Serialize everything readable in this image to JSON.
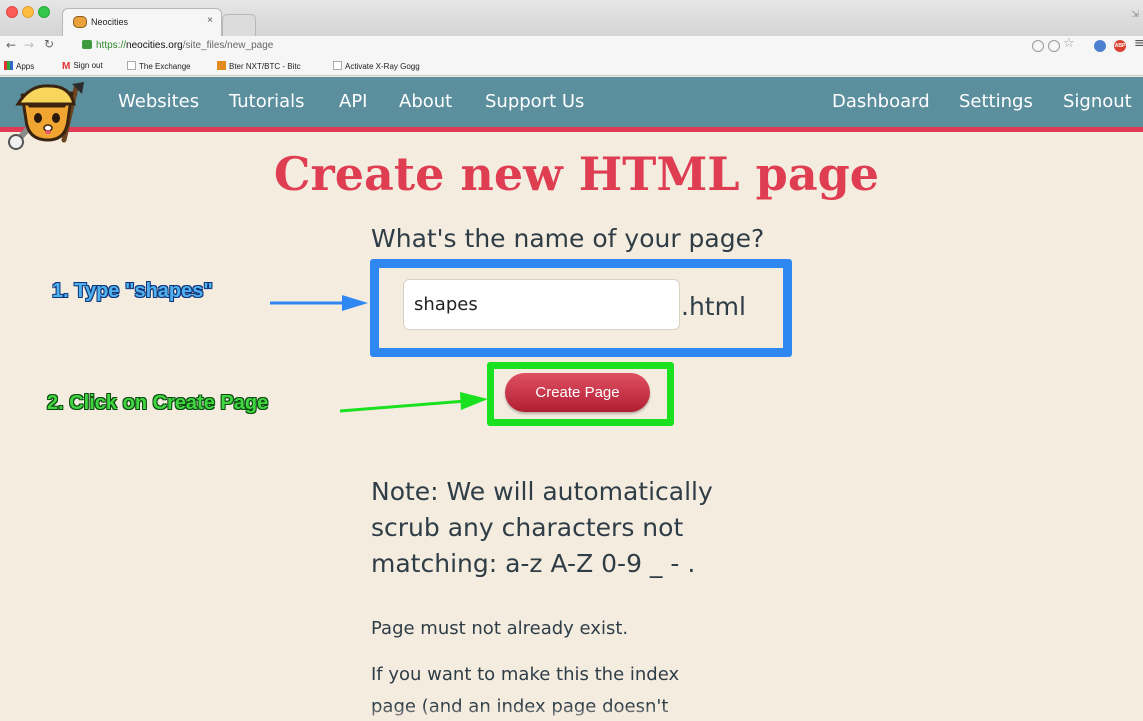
{
  "browser": {
    "tab_title": "Neocities",
    "tab_close": "×",
    "url_scheme": "https://",
    "url_host": "neocities.org",
    "url_path": "/site_files/new_page",
    "bookmarks": [
      "Apps",
      "Sign out",
      "The Exchange",
      "Bter NXT/BTC - Bitc",
      "Activate X-Ray Gogg"
    ],
    "toolbar_icons": [
      "back-icon",
      "forward-icon",
      "reload-icon",
      "lock-icon",
      "shield-icon",
      "zoom-icon",
      "star-icon",
      "globe-icon",
      "adblock-icon",
      "menu-icon"
    ],
    "adblock_label": "ABP"
  },
  "site": {
    "logo_icon": "neocities-cat-logo-icon",
    "nav_left": [
      "Websites",
      "Tutorials",
      "API",
      "About",
      "Support Us"
    ],
    "nav_right": [
      "Dashboard",
      "Settings",
      "Signout"
    ]
  },
  "main": {
    "title": "Create new HTML page",
    "question": "What's the name of your page?",
    "input_value": "shapes",
    "extension": ".html",
    "button_label": "Create Page",
    "note": "Note: We will automatically scrub any characters not matching: a-z A-Z 0-9 _ - .",
    "must_not_exist": "Page must not already exist.",
    "index_line1": "If you want to make this the index",
    "index_line2": "page (and an index page doesn't"
  },
  "annotations": {
    "step1": "1. Type \"shapes\"",
    "step2": "2. Click on Create Page"
  },
  "colors": {
    "header": "#5b8f9e",
    "accent_red": "#df3d52",
    "step1_blue": "#2f88f1",
    "step2_green": "#19e11f",
    "background": "#f4ecdf"
  }
}
